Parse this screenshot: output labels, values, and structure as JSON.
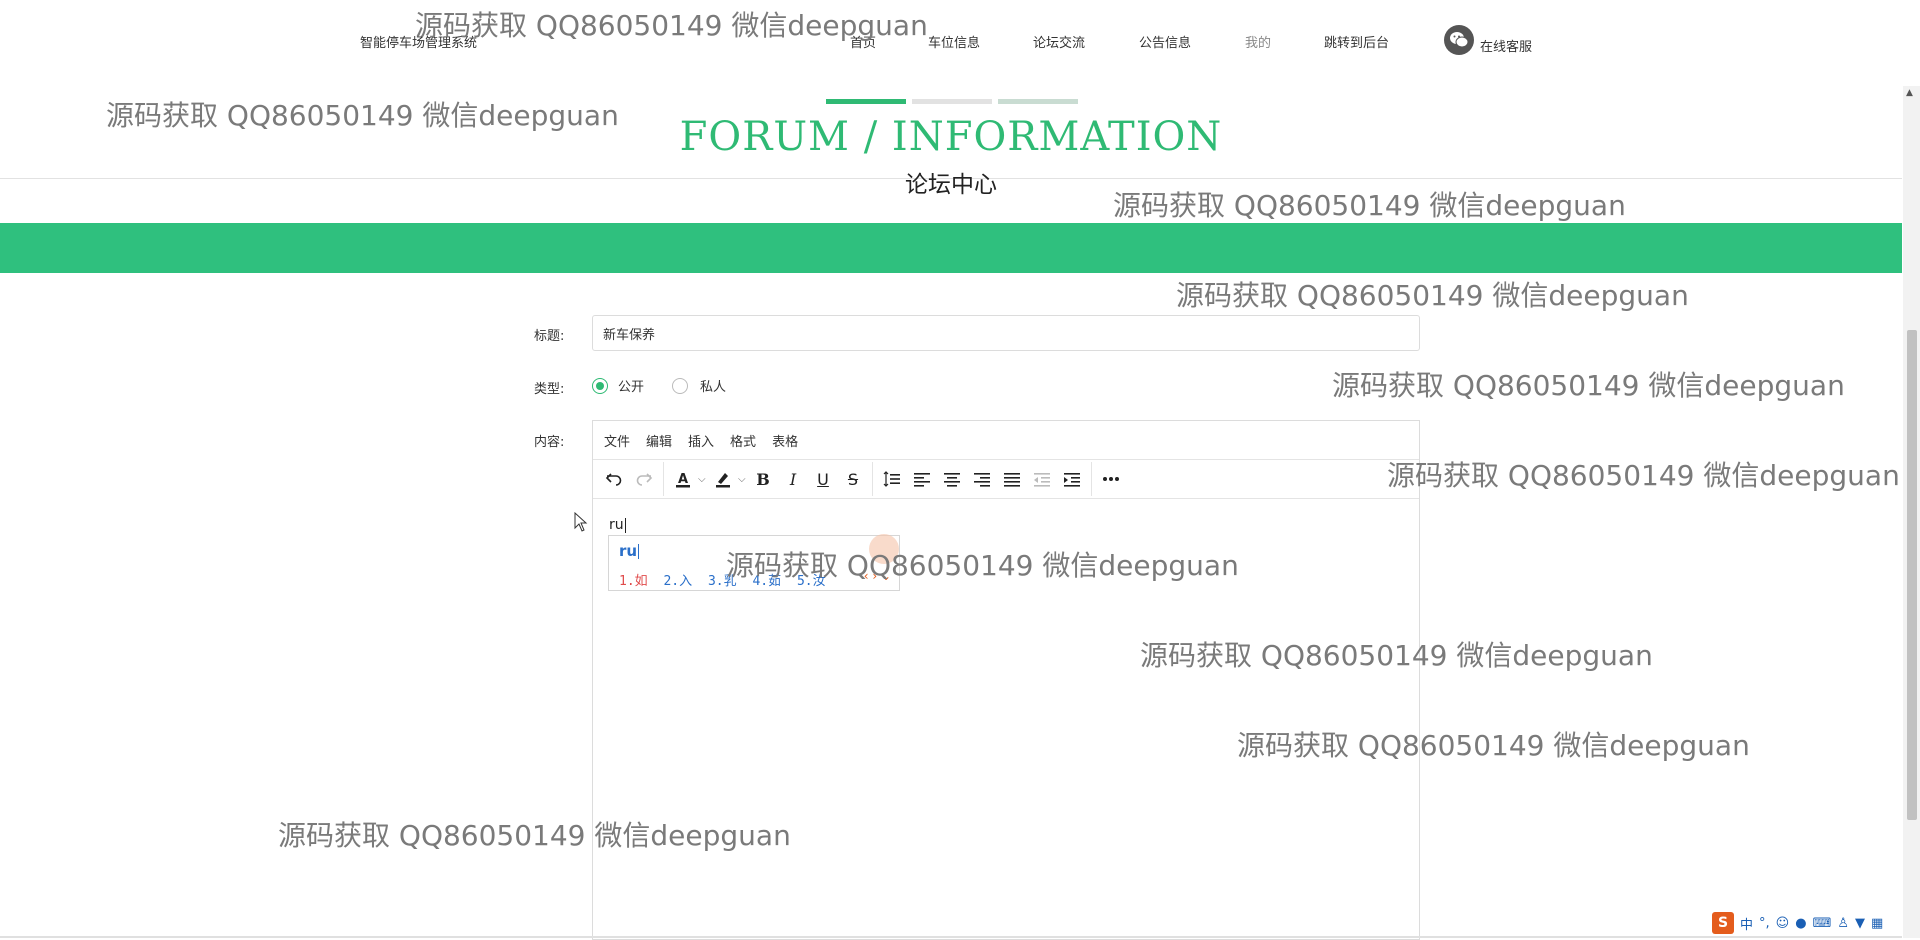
{
  "header": {
    "site_name": "智能停车场管理系统",
    "nav": [
      "首页",
      "车位信息",
      "论坛交流",
      "公告信息",
      "我的",
      "跳转到后台"
    ],
    "service_label": "在线客服",
    "service_icon": "wechat-icon"
  },
  "heading": {
    "english": "FORUM / INFORMATION",
    "chinese": "论坛中心",
    "accent_color": "#2fba74",
    "band_color": "#2fc07e"
  },
  "form": {
    "title_label": "标题:",
    "title_value": "新车保养",
    "type_label": "类型:",
    "type_options": [
      "公开",
      "私人"
    ],
    "type_selected": "公开",
    "content_label": "内容:"
  },
  "editor": {
    "menu": [
      "文件",
      "编辑",
      "插入",
      "格式",
      "表格"
    ],
    "toolbar_icons": [
      "undo-icon",
      "redo-icon",
      "text-color-icon",
      "highlight-icon",
      "bold-icon",
      "italic-icon",
      "underline-icon",
      "strikethrough-icon",
      "line-height-icon",
      "align-left-icon",
      "align-center-icon",
      "align-right-icon",
      "justify-icon",
      "outdent-icon",
      "indent-icon",
      "more-icon"
    ],
    "content_text": "ru"
  },
  "ime": {
    "composition": "ru",
    "candidates": [
      "1.如",
      "2.入",
      "3.乳",
      "4.茹",
      "5.汝"
    ]
  },
  "watermark": {
    "text": "源码获取 QQ86050149 微信deepguan"
  },
  "tray": {
    "logo": "S",
    "mode": "中"
  }
}
